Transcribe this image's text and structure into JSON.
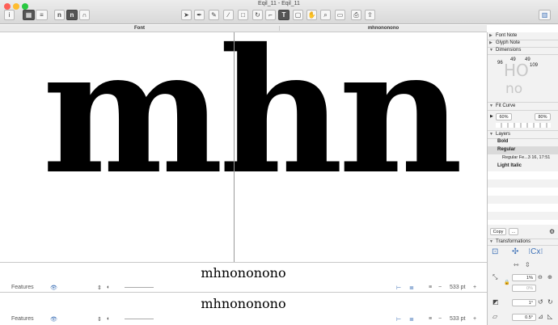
{
  "window": {
    "title": "Eqil_11 - Eqil_11"
  },
  "tabs": [
    "Font",
    "mhnononono"
  ],
  "canvas": {
    "glyphs": "mhn"
  },
  "preview": [
    {
      "text": "mhnononono",
      "features": "Features",
      "size": "533 pt"
    },
    {
      "text": "mhnononono",
      "features": "Features",
      "size": "533 pt"
    }
  ],
  "sidebar": {
    "font_note": "Font Note",
    "glyph_note": "Glyph Note",
    "dimensions": "Dimensions",
    "dim_values": [
      "96",
      "49",
      "49",
      "109"
    ],
    "dim_letters": "HO",
    "dim_letters2": "no",
    "fit_curve": "Fit Curve",
    "fit_left": "60%",
    "fit_right": "80%",
    "layers": "Layers",
    "layer_items": [
      "Bold",
      "Regular",
      "Regular Fe...3 16, 17:51",
      "Light Italic"
    ],
    "copy": "Copy",
    "transformations": "Transformations",
    "scale": "1%",
    "scale2": "0%",
    "rotate": "1°",
    "slant": "0.5°"
  },
  "colors": {
    "accent": "#3b6fb6"
  }
}
